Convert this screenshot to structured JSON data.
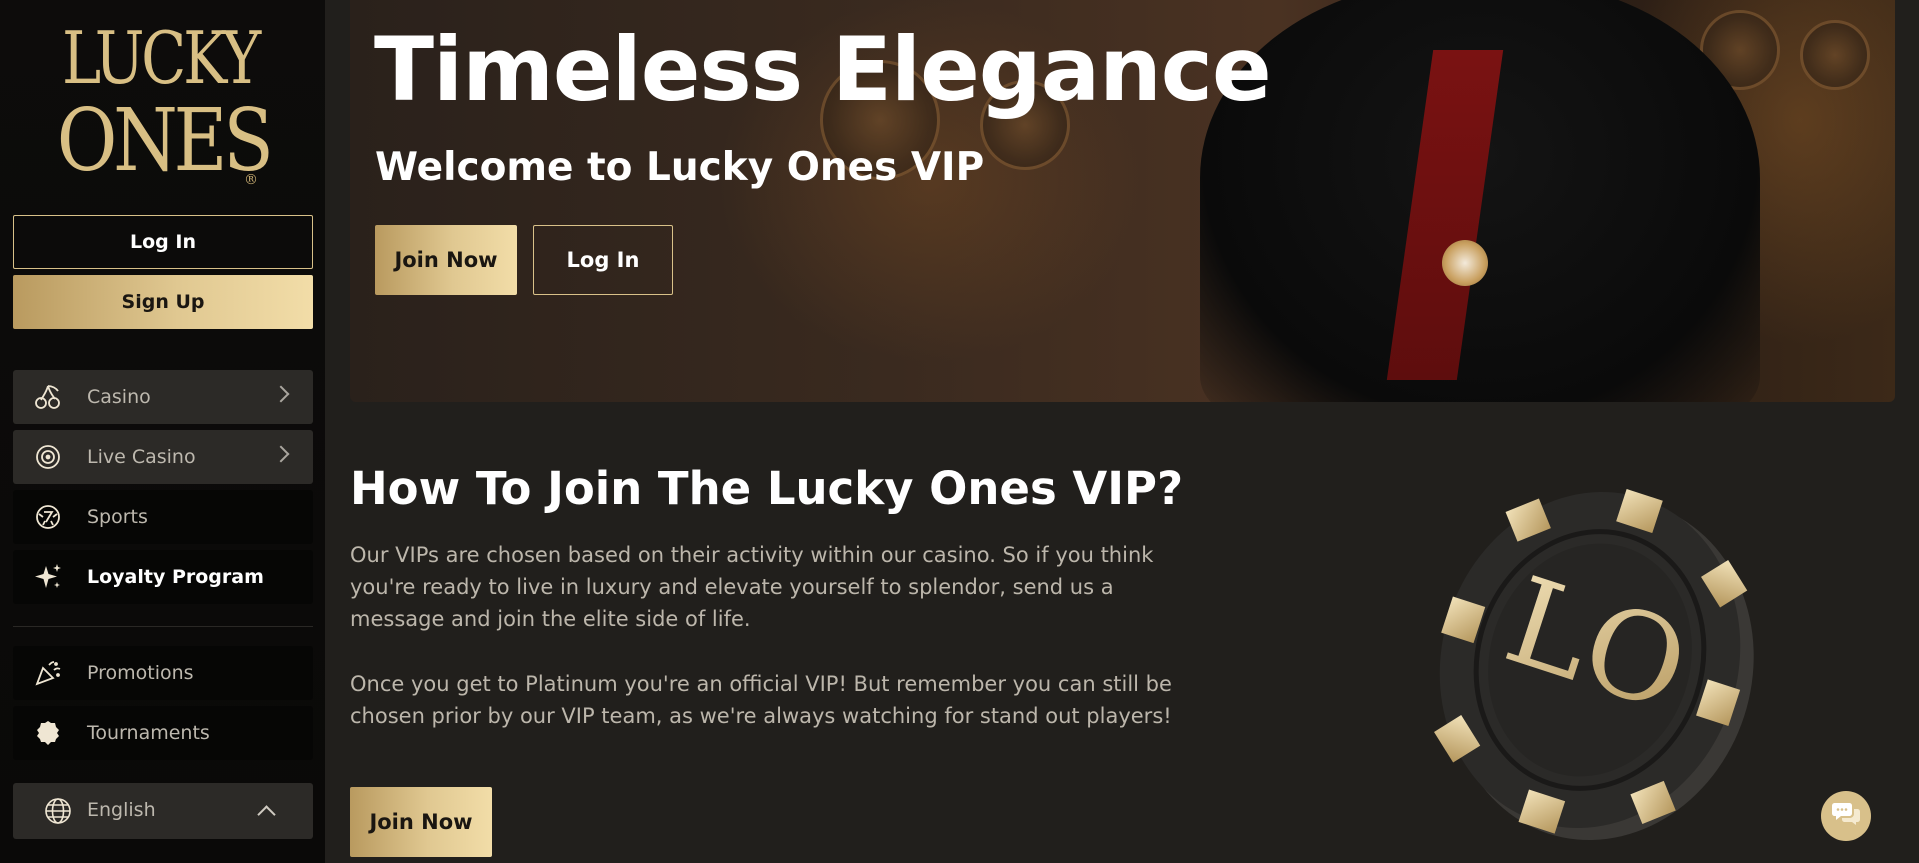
{
  "brand": {
    "logo_line1": "LUCKY",
    "logo_line2": "ONES",
    "logo_mark": "®",
    "colors": {
      "gold": "#d8bf84",
      "background": "#211f1c",
      "sidebar": "#0a0908"
    }
  },
  "auth": {
    "login_label": "Log In",
    "signup_label": "Sign Up"
  },
  "sidebar": {
    "items": [
      {
        "label": "Casino",
        "icon": "cherries-icon",
        "expandable": true
      },
      {
        "label": "Live Casino",
        "icon": "roulette-icon",
        "expandable": true
      },
      {
        "label": "Sports",
        "icon": "ball-icon",
        "expandable": false
      },
      {
        "label": "Loyalty Program",
        "icon": "sparkle-icon",
        "expandable": false,
        "active": true
      },
      {
        "label": "Promotions",
        "icon": "party-popper-icon",
        "expandable": false
      },
      {
        "label": "Tournaments",
        "icon": "award-ribbon-icon",
        "expandable": false
      }
    ],
    "language": {
      "label": "English",
      "icon": "globe-icon"
    }
  },
  "hero": {
    "title": "Timeless Elegance",
    "subtitle": "Welcome to Lucky Ones VIP",
    "join_label": "Join Now",
    "login_label": "Log In"
  },
  "vip": {
    "title": "How To Join The Lucky Ones VIP?",
    "paragraph1": "Our VIPs are chosen based on their activity within our casino. So if you think you're ready to live in luxury and elevate yourself to splendor, send us a message and join the elite side of life.",
    "paragraph2": "Once you get to Platinum you're an official VIP! But remember you can still be chosen prior by our VIP team, as we're always watching for stand out players!",
    "join_label": "Join Now",
    "chip_monogram": "LO"
  },
  "chat": {
    "icon": "chat-bubbles-icon"
  }
}
